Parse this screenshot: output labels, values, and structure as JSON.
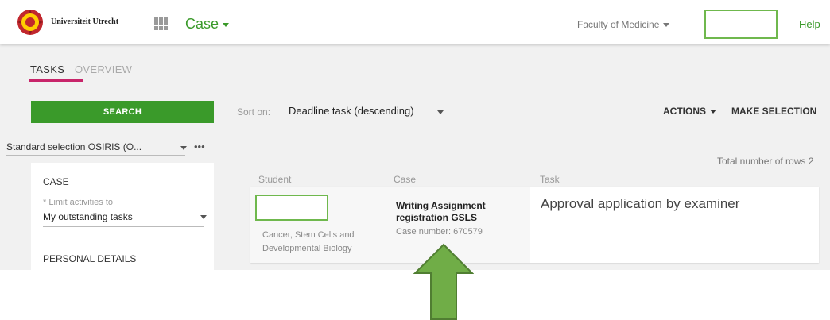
{
  "header": {
    "university": "Universiteit Utrecht",
    "app": "Case",
    "faculty": "Faculty of Medicine",
    "user_box": "",
    "help": "Help"
  },
  "tabs": [
    {
      "label": "TASKS",
      "active": true
    },
    {
      "label": "OVERVIEW",
      "active": false
    }
  ],
  "sidebar": {
    "search_label": "SEARCH",
    "selection": "Standard selection OSIRIS (O...",
    "more": "•••",
    "case_section": "CASE",
    "limit_label": "* Limit activities to",
    "limit_value": "My outstanding tasks",
    "personal_section": "PERSONAL DETAILS"
  },
  "toolbar": {
    "sort_label": "Sort on:",
    "sort_value": "Deadline task (descending)",
    "actions": "ACTIONS",
    "make_selection": "MAKE SELECTION"
  },
  "table": {
    "total": "Total number of rows 2",
    "columns": [
      "Student",
      "Case",
      "Task"
    ],
    "rows": [
      {
        "student_name": "",
        "program": "Cancer, Stem Cells and Developmental Biology",
        "case_title": "Writing Assignment registration GSLS",
        "case_number": "Case number: 670579",
        "task": "Approval application by examiner"
      }
    ]
  },
  "colors": {
    "brand_green": "#3a9a2a",
    "tab_indicator": "#c8256a",
    "annotation_green": "#6fb84d",
    "logo_red": "#c1272d",
    "logo_yellow": "#ffcd00"
  }
}
